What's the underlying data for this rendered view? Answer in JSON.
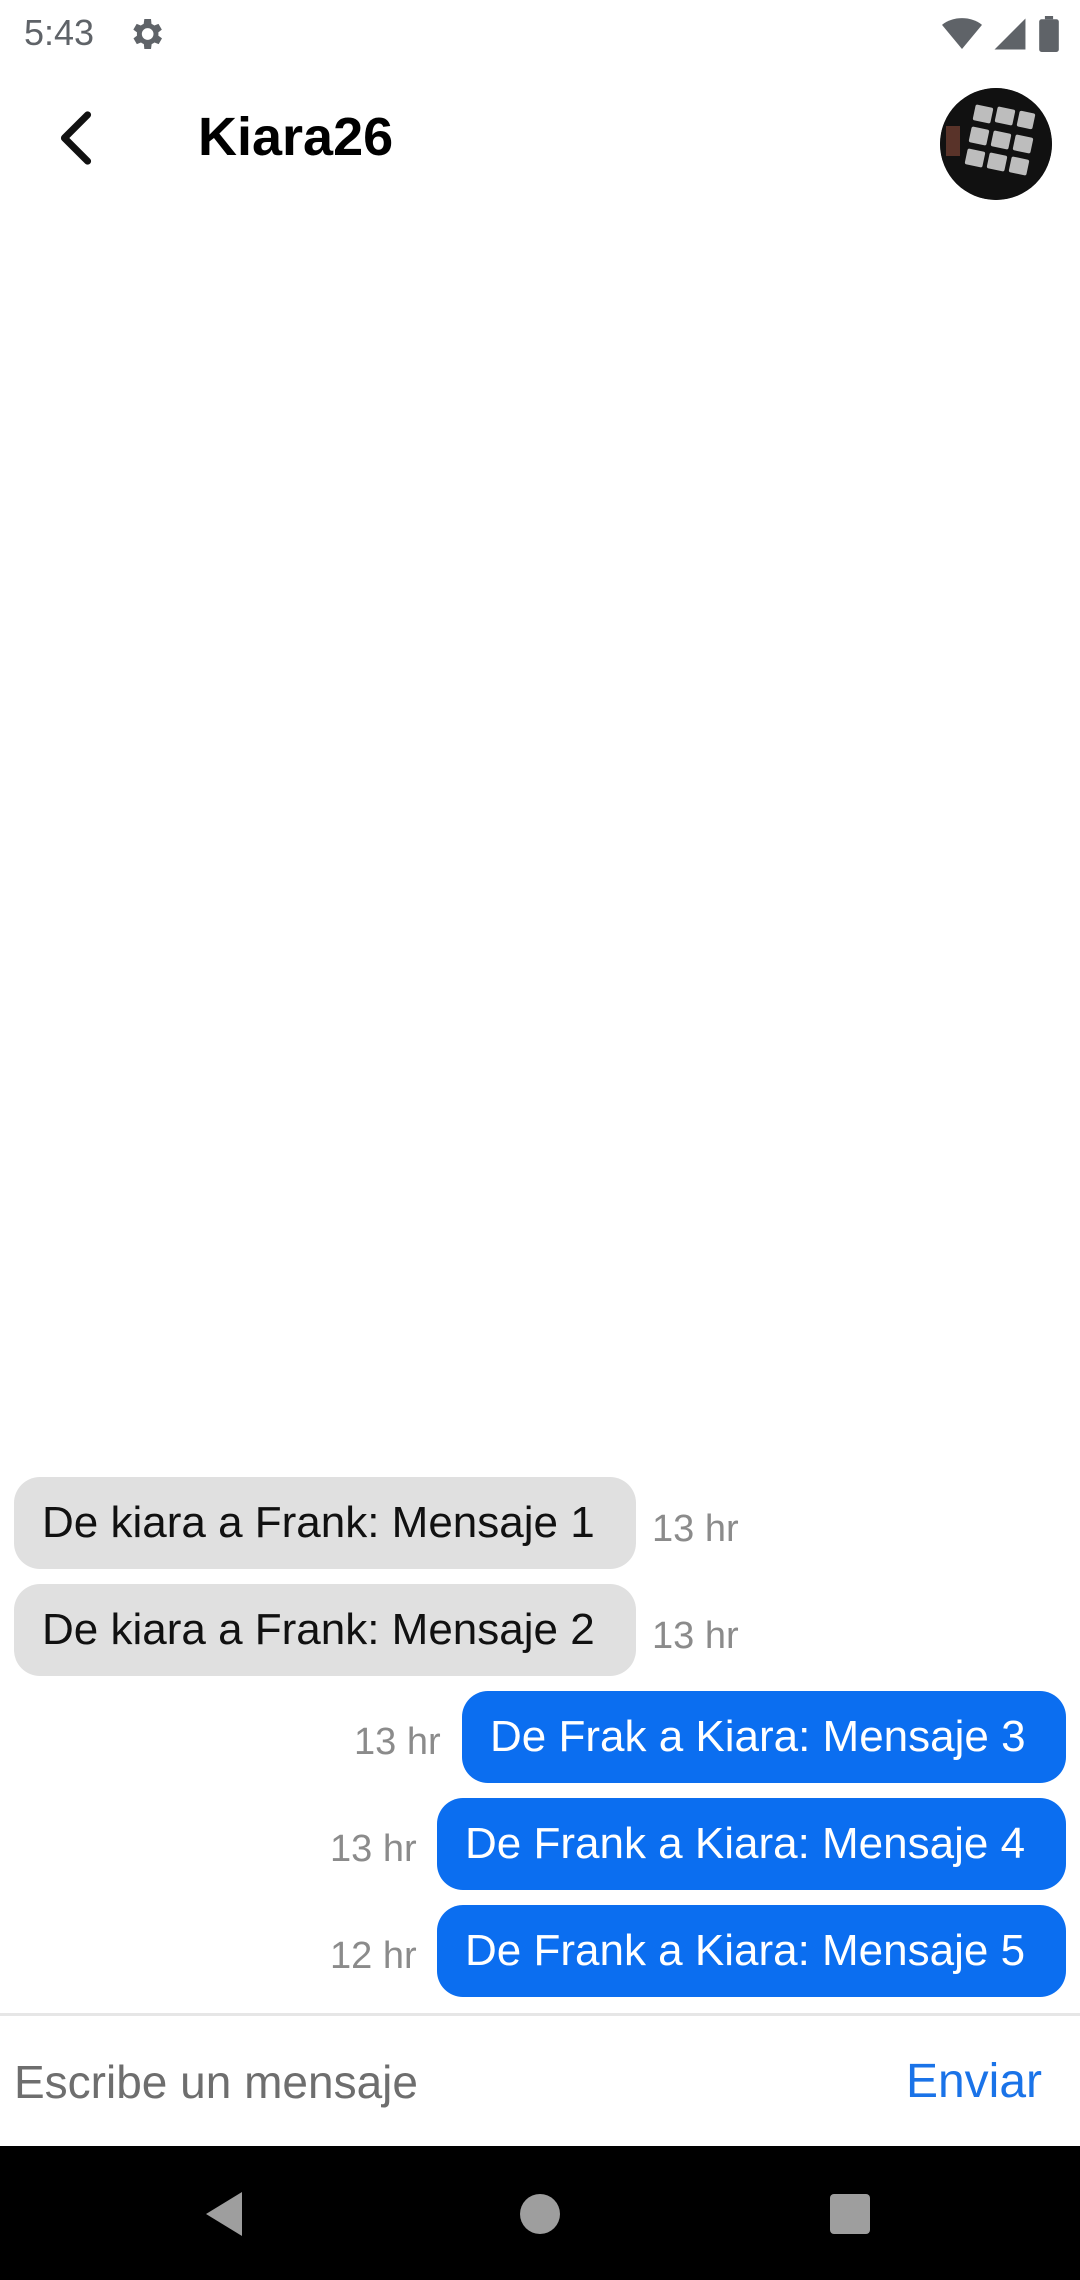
{
  "status_bar": {
    "time": "5:43",
    "icons": [
      "settings-gear-icon",
      "wifi-icon",
      "cellular-signal-icon",
      "battery-icon"
    ]
  },
  "header": {
    "title": "Kiara26",
    "back_icon": "chevron-left-icon",
    "avatar": "profile-avatar"
  },
  "messages": [
    {
      "direction": "incoming",
      "text": "De kiara a Frank: Mensaje 1",
      "time": "13 hr"
    },
    {
      "direction": "incoming",
      "text": "De kiara a Frank: Mensaje 2",
      "time": "13 hr"
    },
    {
      "direction": "outgoing",
      "text": "De Frak a Kiara: Mensaje 3",
      "time": "13 hr"
    },
    {
      "direction": "outgoing",
      "text": "De Frank a Kiara: Mensaje 4",
      "time": "13 hr"
    },
    {
      "direction": "outgoing",
      "text": "De Frank a Kiara: Mensaje 5",
      "time": "12 hr"
    }
  ],
  "composer": {
    "placeholder": "Escribe un mensaje",
    "value": "",
    "send_label": "Enviar"
  },
  "nav_bar": {
    "icons": [
      "back-triangle-icon",
      "home-circle-icon",
      "recents-square-icon"
    ]
  },
  "colors": {
    "outgoing_bubble": "#0b6ef0",
    "incoming_bubble": "#e0e0e0",
    "send_text": "#1a73e8",
    "timestamp": "#8b8b8b"
  }
}
